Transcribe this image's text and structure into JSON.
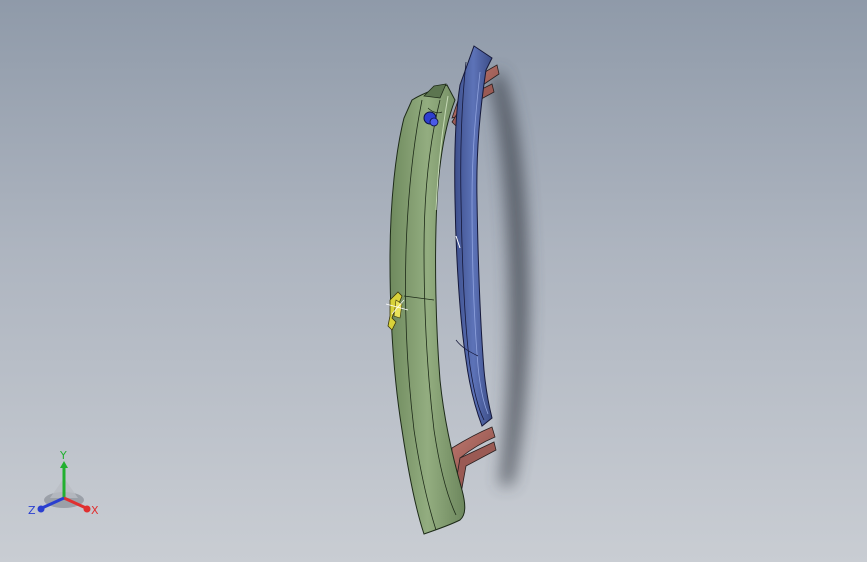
{
  "viewport": {
    "background_top": "#8f9aa9",
    "background_bottom": "#c9cdd3"
  },
  "model": {
    "parts": [
      {
        "name": "front-rail",
        "color": "#7f9a6e"
      },
      {
        "name": "rear-rail",
        "color": "#4a5e9b"
      },
      {
        "name": "top-bracket",
        "color": "#a0625b"
      },
      {
        "name": "bottom-bracket",
        "color": "#a0625b"
      },
      {
        "name": "pin",
        "color": "#2e3fcf"
      },
      {
        "name": "clip",
        "color": "#d8d23a"
      }
    ]
  },
  "triad": {
    "x_label": "X",
    "y_label": "Y",
    "z_label": "Z",
    "x_color": "#e03030",
    "y_color": "#22b030",
    "z_color": "#2a3fd0"
  }
}
